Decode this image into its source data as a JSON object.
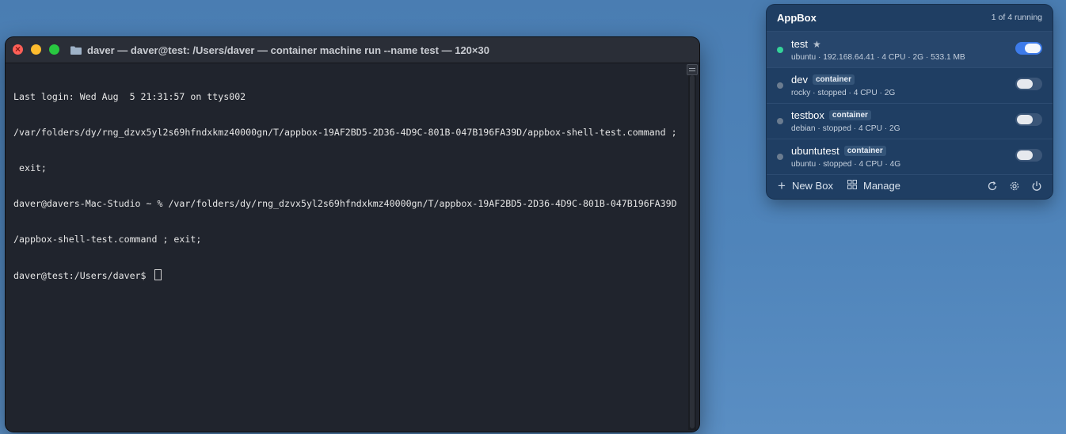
{
  "terminal": {
    "title": "daver — daver@test: /Users/daver — container machine run --name test — 120×30",
    "lines": [
      "Last login: Wed Aug  5 21:31:57 on ttys002",
      "/var/folders/dy/rng_dzvx5yl2s69hfndxkmz40000gn/T/appbox-19AF2BD5-2D36-4D9C-801B-047B196FA39D/appbox-shell-test.command ;",
      " exit;",
      "daver@davers-Mac-Studio ~ % /var/folders/dy/rng_dzvx5yl2s69hfndxkmz40000gn/T/appbox-19AF2BD5-2D36-4D9C-801B-047B196FA39D",
      "/appbox-shell-test.command ; exit;",
      "daver@test:/Users/daver$ "
    ]
  },
  "appbox": {
    "title": "AppBox",
    "status": "1 of 4 running",
    "boxes": [
      {
        "name": "test",
        "tag": "",
        "starred": true,
        "running": true,
        "meta": "ubuntu · 192.168.64.41 · 4 CPU · 2G · 533.1 MB"
      },
      {
        "name": "dev",
        "tag": "container",
        "starred": false,
        "running": false,
        "meta": "rocky · stopped · 4 CPU · 2G"
      },
      {
        "name": "testbox",
        "tag": "container",
        "starred": false,
        "running": false,
        "meta": "debian · stopped · 4 CPU · 2G"
      },
      {
        "name": "ubuntutest",
        "tag": "container",
        "starred": false,
        "running": false,
        "meta": "ubuntu · stopped · 4 CPU · 4G"
      }
    ],
    "footer": {
      "new_box": "New Box",
      "manage": "Manage"
    }
  },
  "colors": {
    "running": "#34d399",
    "toggle_on": "#3d7bea",
    "panel_bg": "#1f3e63",
    "terminal_bg": "#20242d"
  }
}
